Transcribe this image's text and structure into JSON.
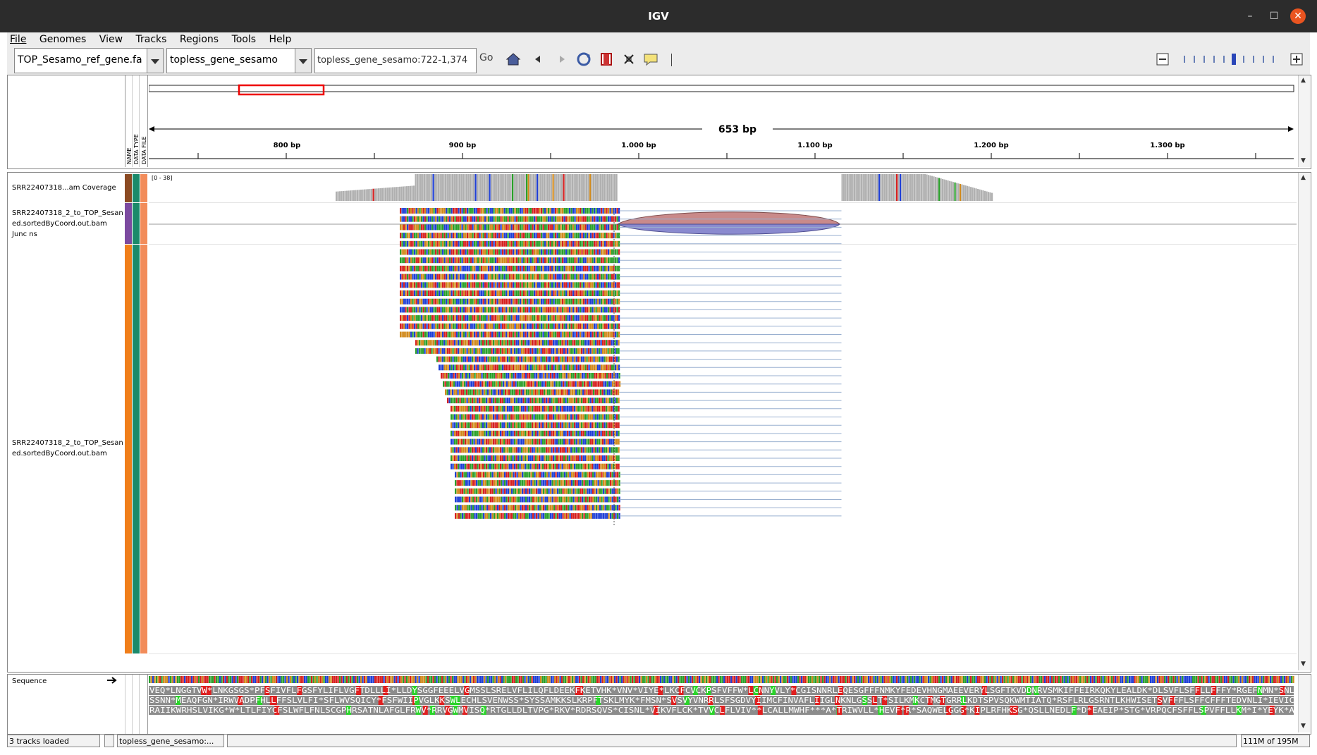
{
  "window": {
    "title": "IGV"
  },
  "menu": [
    "File",
    "Genomes",
    "View",
    "Tracks",
    "Regions",
    "Tools",
    "Help"
  ],
  "toolbar": {
    "genome": "TOP_Sesamo_ref_gene.fa",
    "chromosome": "topless_gene_sesamo",
    "locus": "topless_gene_sesamo:722-1,374",
    "go_label": "Go"
  },
  "ruler": {
    "span_label": "653 bp",
    "ticks": [
      "800 bp",
      "900 bp",
      "1.000 bp",
      "1.100 bp",
      "1.200 bp",
      "1.300 bp"
    ],
    "headers": [
      "NAME",
      "DATA TYPE",
      "DATA FILE"
    ]
  },
  "tracks": {
    "coverage_name": "SRR22407318...am Coverage",
    "coverage_range": "[0 - 38]",
    "junctions_name": "SRR22407318_2_to_TOP_Sesan ed.sortedByCoord.out.bam Junc ns",
    "alignment_name": "SRR22407318_2_to_TOP_Sesan ed.sortedByCoord.out.bam",
    "sequence_name": "Sequence"
  },
  "translation": {
    "frame1": "VEQ*LNGGTVW*LNKGSGS*PFSFIVFLFGSFYLIFLVGFTDLLLI*LLDYSGGFEEELVGMSSLSRELVFLILQFLDEEKFKETVHK*VNV*VIYE*LKCFCVCKPSFVFFW*LCNNYVLY*CGISNNRLEQESGFFFNMKYFEDEVHNGMAEEVERYLSGFTKVDDNRVSMKIFFEIRKQKYLEALDK*DLSVFLSFFLLFFFY*RGEFNMN*SNL",
    "frame2": "SSNN*MEAQFGN*IRWVADPFHLLFFSLVLFI*SFLWVSQICY*FSFWIIPVGLKKSWLECHLSVENWSS*SYSSAMKKSLKRPFTSKLMYK*FMSN*SVSVYVNRRLSFSGDVYIIMCFINVAFLIIGLNKNLGSSLT*SILKMKCTMGTGRRLKDTSPVSQKWMTIATQ*RSFLRLGSRNTLKHWISETSVFFFLSFFCFFFTEDVNLI*IEVIC",
    "frame3": "RAIIKWRHSLVIKG*W*LTLFIYCFSLWFLFNLSCGPHRSATNLAFGLFRWV*RRVGWMVISQ*RTGLLDLTVPG*RKV*RDRSQVS*CISNL*VIKVFLCK*TVVCLFLVIV**LCALLMWHF***A*TRIWVLL*HEVF*R*SAQWELGGG*KIPLRFHKSG*QSLLNEDLF*D*EAEIP*STG*VRPQCFSFFLSPVFFLLKM*I*YEYK*A"
  },
  "status": {
    "tracks_loaded": "3 tracks loaded",
    "locus": "topless_gene_sesamo:...",
    "memory": "111M of 195M"
  },
  "colors": {
    "A": "#2aa02a",
    "C": "#1f3fd6",
    "G": "#d18a1c",
    "T": "#d62020",
    "coverage": "#b0b0b0",
    "junction_plus": "#c98a8a",
    "junction_minus": "#8a8acf",
    "title_bg": "#2c2c2c",
    "close": "#e95420"
  },
  "chart_data": {
    "coverage": {
      "region1": [
        840,
        1000
      ],
      "region2": [
        1127,
        1213
      ],
      "peak_depth": 38
    },
    "junction": {
      "start": 1001,
      "end": 1127
    }
  }
}
